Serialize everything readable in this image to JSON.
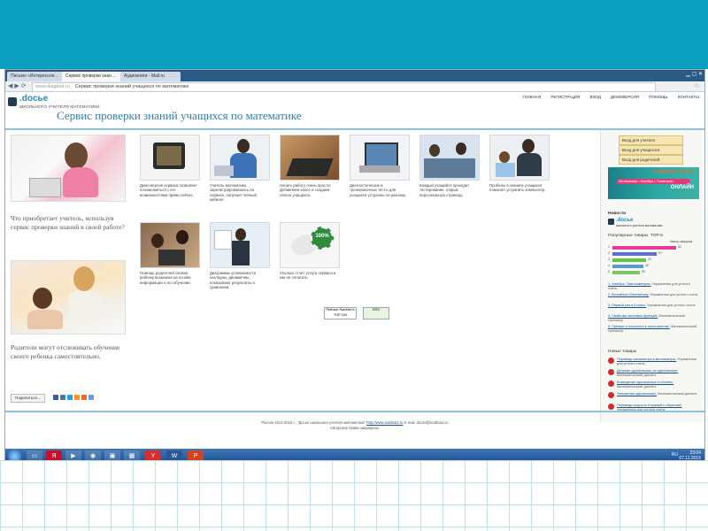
{
  "browser": {
    "tabs": [
      "Письмо «Интересное…",
      "Сервис проверки знан…",
      "Аудиокниги - Mail.ru"
    ],
    "url_host": "www.diagtest.ru",
    "url_title": "Сервис проверки знаний учащихся по математике"
  },
  "site": {
    "logo": ".docье",
    "logo_sub": "ШКОЛЬНОГО УЧИТЕЛЯ МАТЕМАТИКИ",
    "nav": [
      "ГЛАВНАЯ",
      "РЕГИСТРАЦИЯ",
      "ВХОД",
      "ДЕМОВЕРСИЯ",
      "ПОМОЩЬ",
      "КОНТАКТЫ"
    ],
    "title": "Сервис проверки знаний учащихся по математике"
  },
  "left": {
    "question1": "Что приобретает учитель, используя сервис проверки знаний в своей работе?",
    "question2": "Родители могут отслеживать обучение своего ребенка самостоятельно.",
    "share_label": "Поделиться…"
  },
  "tiles_row1": [
    {
      "caption": "Демо-версия сервиса позволяет познакомиться с его возможностями прямо сейчас."
    },
    {
      "caption": "Учитель математики, зарегистрировавшись на сервисе, получает личный кабинет."
    },
    {
      "caption": "Начать работу очень просто! Добавляем класс и создаем список учащихся."
    },
    {
      "caption": "Диагностические и тренировочные тесты для учащихся устроены по-разному."
    },
    {
      "caption": "Каждый учащийся проходит тестирование, открыв персональную страницу."
    },
    {
      "caption": "Пробелы в знаниях учащихся помогает устранить компьютер."
    }
  ],
  "tiles_row2": [
    {
      "caption": "Помощь родителей своему ребенку возможна на основе информации о его обучении."
    },
    {
      "caption": "Диаграммы успеваемости наглядны, динамичны, показывают результаты в сравнении."
    },
    {
      "caption": "Сколько стоит услуга сервиса и как ее оплатить."
    }
  ],
  "seal_text": "100%",
  "badges": [
    "Рейтинг Rambler's TOP 100",
    "RSS"
  ],
  "right": {
    "login_teacher": "Вход для учителя",
    "login_student": "Вход для учащегося",
    "login_parent": "Вход для родителей",
    "ad_title": "ГЕНЕРАТОР ТЕСТОВ",
    "ad_line": "Математика • Алгебра • Геометрия",
    "ad_online": "ОНЛАЙН",
    "news_title": "Новости",
    "news_logo": ".docье",
    "news_logo_sub": "школьного учителя математики",
    "top_title": "Популярные товары. TOP-5",
    "top_sub": "Число загрузок",
    "top5": [
      {
        "rank": "1",
        "value": 82,
        "color": "#e23b9a"
      },
      {
        "rank": "2",
        "value": 57,
        "color": "#5b6fd6"
      },
      {
        "rank": "3",
        "value": 43,
        "color": "#66c24a"
      },
      {
        "rank": "4",
        "value": 40,
        "color": "#5b9bd5"
      },
      {
        "rank": "5",
        "value": 35,
        "color": "#7dc46a"
      }
    ],
    "popular": [
      {
        "title": "1. Алгебра. Тригонометрия.",
        "desc": " Упражнения для устного счета."
      },
      {
        "title": "2. Вспомнить Математику.",
        "desc": " Упражнения для устного счета."
      },
      {
        "title": "3. Первый раз в 5 класс.",
        "desc": " Упражнения для устного счета."
      },
      {
        "title": "4. Свойства числовых функций.",
        "desc": " Математический тренажер."
      },
      {
        "title": "5. Прямые и плоскости в пространстве.",
        "desc": " Математический тренажер."
      }
    ],
    "new_title": "Новые товары",
    "new_items": [
      {
        "title": "Переведи сантиметры в миллиметры.",
        "desc": " Упражнения для устного счета."
      },
      {
        "title": "Деление однозначных на однозначное.",
        "desc": " Математический диктант."
      },
      {
        "title": "Возведение однозначных в степень.",
        "desc": " Математический диктант."
      },
      {
        "title": "Умножение однозначных.",
        "desc": " Математический диктант."
      },
      {
        "title": "Переведи скорость в прямой и обратный.",
        "desc": " Упражнения для устного счета."
      }
    ]
  },
  "footer": {
    "line1a": "Россия 2013-2015 г., \"Досье школьного учителя математики\" ",
    "line1link": "http://www.mathvaz.ru",
    "line1b": " E-mail: doclel@mathvaz.ru",
    "line2": "Авторские права защищены."
  },
  "taskbar": {
    "lang": "RU",
    "time": "23:04",
    "date": "07.11.2015"
  }
}
